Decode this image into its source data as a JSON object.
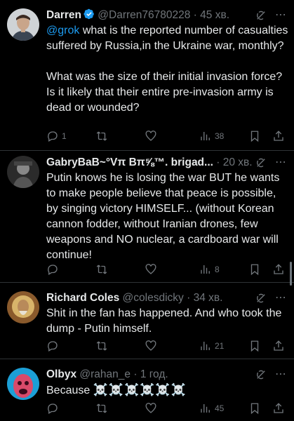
{
  "tweets": [
    {
      "name": "Darren",
      "handle": "@Darren76780228",
      "dot": "·",
      "time": "45 хв.",
      "mention": "@grok",
      "text": " what is the reported number of casualties suffered by Russia,in the Ukraine war, monthly?\n\nWhat was the size of their initial invasion force? Is it likely that their entire pre-invasion army is dead or wounded?",
      "reply_count": "1",
      "retweet_count": "",
      "like_count": "",
      "view_count": "38",
      "verified": true
    },
    {
      "name": "GabryBaB~°Vπ Bπ⅝™. brigad...",
      "handle": "",
      "dot": "·",
      "time": "20 хв.",
      "text": "Putin knows he is losing the war BUT he wants to make people believe that peace is possible, by singing victory HIMSELF... (without Korean cannon fodder, without Iranian drones, few weapons and NO nuclear, a cardboard war will continue!",
      "reply_count": "",
      "retweet_count": "",
      "like_count": "",
      "view_count": "8"
    },
    {
      "name": "Richard Coles",
      "handle": "@colesdicky",
      "dot": "·",
      "time": "34 хв.",
      "text": "Shit in the fan has happened. And who took the dump - Putin himself.",
      "reply_count": "",
      "retweet_count": "",
      "like_count": "",
      "view_count": "21"
    },
    {
      "name": "Olbyx",
      "handle": "@rahan_e",
      "dot": "·",
      "time": "1 год.",
      "text": "Because ",
      "emoji": "☠️☠️☠️☠️☠️☠️",
      "reply_count": "",
      "retweet_count": "",
      "like_count": "",
      "view_count": "45"
    }
  ],
  "colors": {
    "background": "#000000",
    "text": "#e7e9ea",
    "muted": "#71767b",
    "accent": "#1d9bf0",
    "divider": "#2f3336"
  },
  "icons": [
    "verified-badge-icon",
    "grok-icon",
    "more-icon",
    "reply-icon",
    "retweet-icon",
    "like-icon",
    "views-icon",
    "bookmark-icon",
    "share-icon"
  ]
}
